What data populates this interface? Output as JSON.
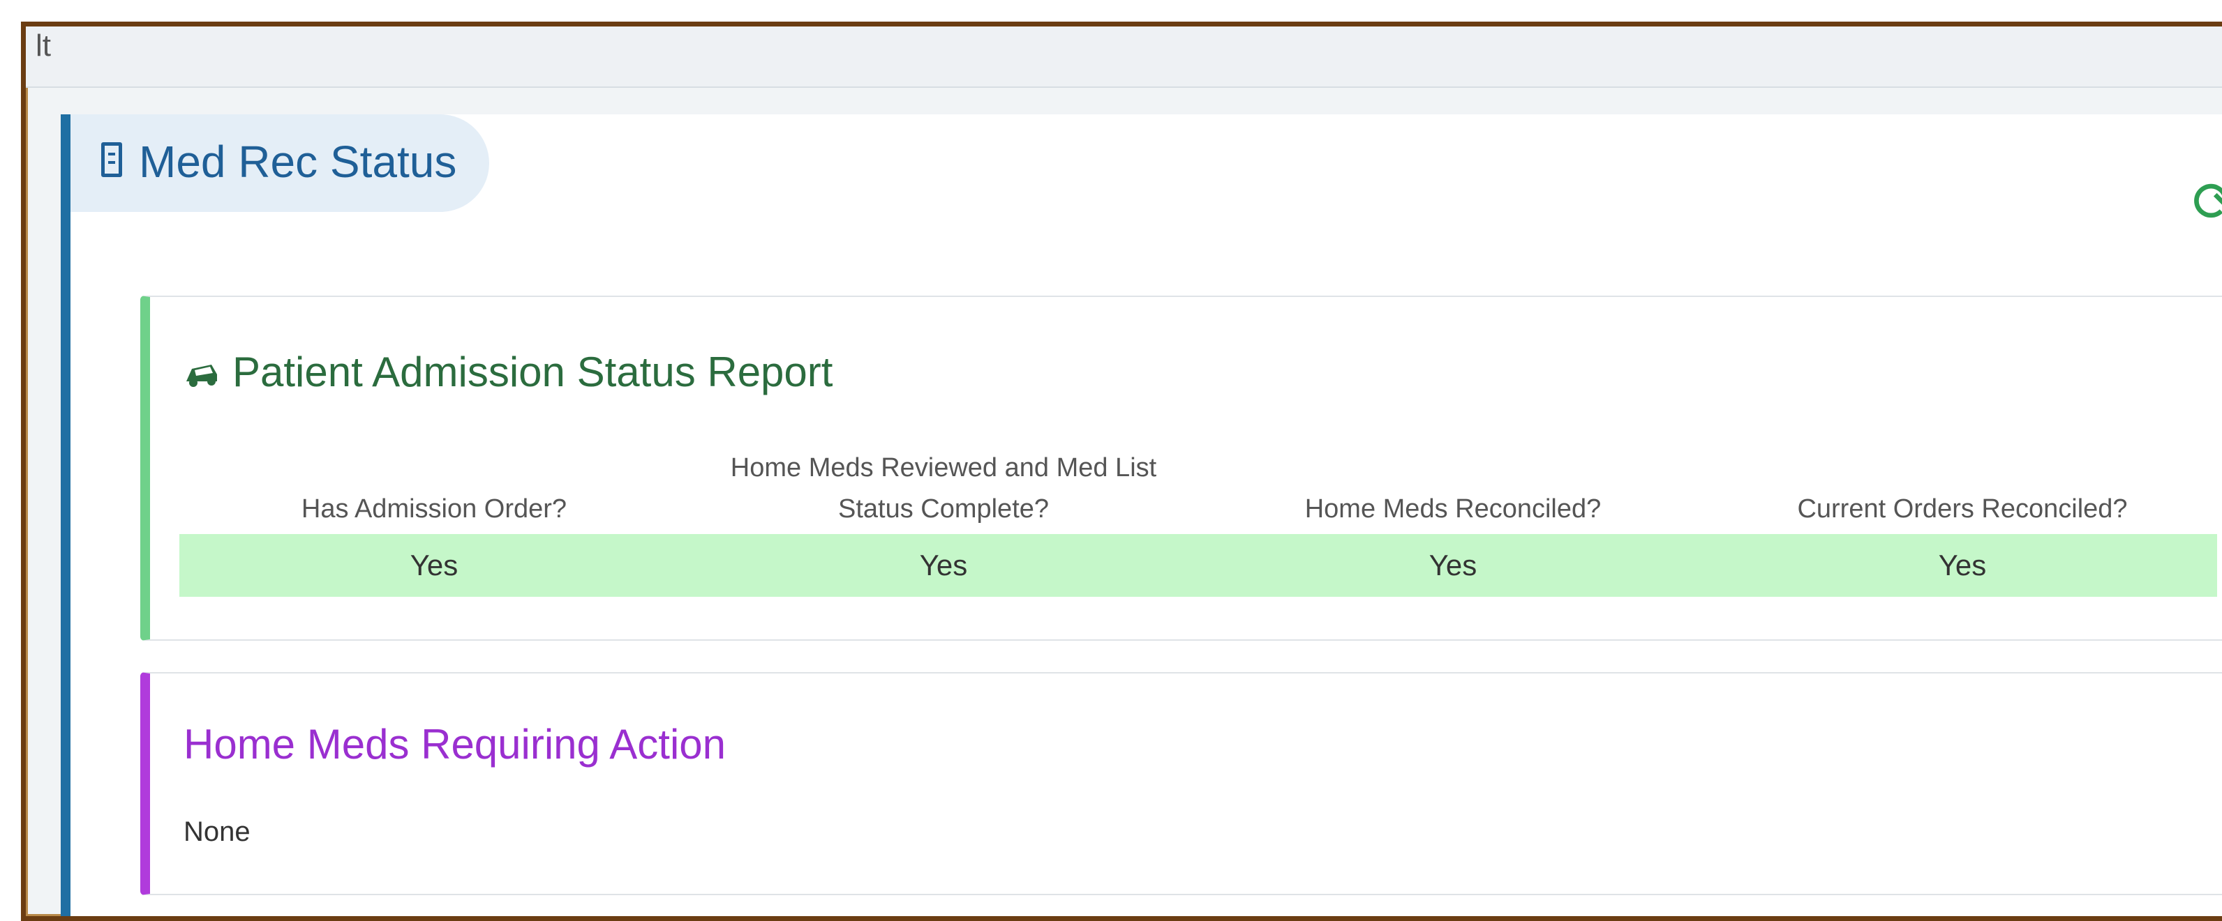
{
  "top_strip": {
    "stub_text": "lt"
  },
  "panel": {
    "title": "Med Rec Status",
    "title_icon": "document-icon",
    "refresh_icon": "refresh-icon"
  },
  "admission_report": {
    "title": "Patient Admission Status Report",
    "icon": "car-icon",
    "columns": [
      {
        "header": "Has Admission Order?",
        "value": "Yes"
      },
      {
        "header": "Home Meds Reviewed and Med List\nStatus Complete?",
        "value": "Yes"
      },
      {
        "header": "Home Meds Reconciled?",
        "value": "Yes"
      },
      {
        "header": "Current Orders Reconciled?",
        "value": "Yes"
      }
    ]
  },
  "home_meds": {
    "title": "Home Meds Requiring Action",
    "content": "None"
  },
  "colors": {
    "panel_accent": "#1f6fa3",
    "admission_accent": "#6fd18a",
    "home_meds_accent": "#b03bdc",
    "status_row_bg": "#c5f7c9",
    "refresh_color": "#2e9e52"
  }
}
